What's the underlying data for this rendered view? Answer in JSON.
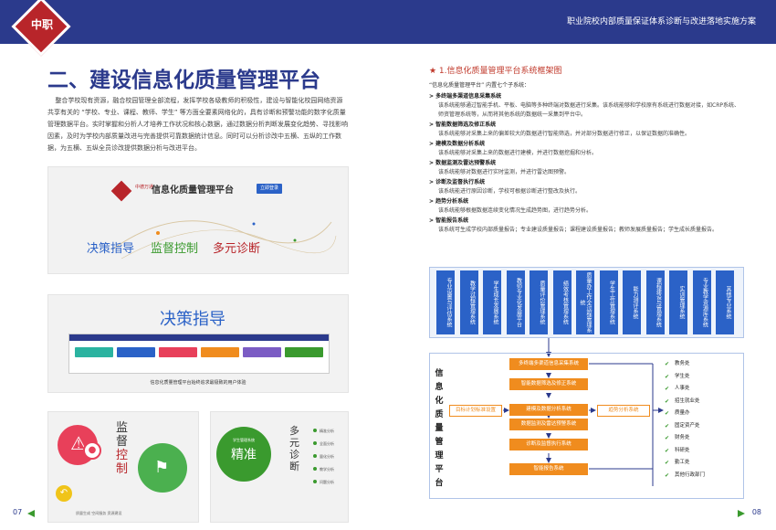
{
  "header": {
    "logo_text": "中职",
    "title": "职业院校内部质量保证体系诊断与改进落地实施方案"
  },
  "left": {
    "section_title": "二、建设信息化质量管理平台",
    "intro": "整合学校现有资源，融合校园管理全部流程，发挥学校各级教师的积极性，建设与智能化校园网络资源共享有关的 “学校、专业、课程、教师、学生” 等方面全要素网络化的，具有诊断和预警功能的数字化质量管理数据平台。实时掌握和分析人才培养工作状况和核心数据，通过数据分析判断发展变化趋势、寻找影响因素，及时为学校内部质量改进与完善提供可靠数据统计信息。同时可以分析诊改中五横、五纵的工作数据，为五横、五纵全员诊改提供数据分析与改进平台。",
    "card1": {
      "brand_small": "中德万通",
      "brand_name": "信息化质量管理平台",
      "login": "立即登录",
      "slogan1": "决策指导",
      "slogan2": "监督控制",
      "slogan3": "多元诊断"
    },
    "card2": {
      "title": "决策指导",
      "caption": "信息化质量管理平台始终追求最极致的用户体验",
      "tile_colors": [
        "#2bb3a0",
        "#2b62c7",
        "#e8405a",
        "#f08c1e",
        "#7b5cc4",
        "#3a9a2e"
      ]
    },
    "card3": {
      "vert1": "监督",
      "vert2": "控制",
      "caption": "质量生成  空间服务  资源建设"
    },
    "card4": {
      "circle_small": "学生管理系统",
      "circle_big": "精准",
      "vert": "多元诊断",
      "list": [
        "精准分析",
        "全面分析",
        "量化分析",
        "教学分析",
        "问题分析"
      ]
    },
    "page_num": "07"
  },
  "right": {
    "heading": "★ 1.信息化质量管理平台系统框架图",
    "lead": "“信息化质量管理平台” 内置七个子系统：",
    "items": [
      {
        "title": "> 多终端多渠道信息采集系统",
        "desc": "该系统能够通过智能手机、平板、电脑等多种终端对数据进行采集。该系统能够和学校原有系统进行数据对接，如CRP系统、师资管理系统等，从而将其他系统的数据统一采集到平台中。"
      },
      {
        "title": "> 智能数据筛选及修正系统",
        "desc": "该系统能够对采集上来的偏差较大的数据进行智能筛选，并对部分数据进行修正，以保证数据的准确性。"
      },
      {
        "title": "> 建模及数据分析系统",
        "desc": "该系统能够对采集上来的数据进行建模，并进行数据挖掘和分析。"
      },
      {
        "title": "> 数据监测及雷达预警系统",
        "desc": "该系统能够对数据进行实时监测，并进行雷达图预警。"
      },
      {
        "title": "> 诊断及监督执行系统",
        "desc": "该系统能进行原因诊断，学校可根据诊断进行整改及执行。"
      },
      {
        "title": "> 趋势分析系统",
        "desc": "该系统能够根据数据连续变化情况生成趋势图，进行趋势分析。"
      },
      {
        "title": "> 智能报告系统",
        "desc": "该系统可生成学校内部质量报告；专业建设质量报告；课程建设质量报告；教师发展质量报告；学生成长质量报告。"
      }
    ],
    "flow": {
      "subsystems": [
        "专业设置与评估系统",
        "教学过程管理系统",
        "学生成长发展系统",
        "教师专业化发展平台",
        "质量评价管理系统",
        "绩效考核管理系统",
        "质量办工作全过程管理系统",
        "学生工作管理系统",
        "能力测评系统",
        "课程建设与管理系统",
        "实训管理系统",
        "专业教学资源库系统",
        "其他专业系统"
      ],
      "platform_label": "信息化质量管理平台",
      "main_boxes": [
        "多终端多渠道信息采集系统",
        "智能数据筛选及修正系统",
        "建模及数据分析系统",
        "数据监测及雷达预警系统",
        "诊断及监督执行系统",
        "智能报告系统"
      ],
      "target_box": "目标计划标准设置",
      "trend_box": "趋势分析系统",
      "departments": [
        "教务处",
        "学生处",
        "人事处",
        "招生就业处",
        "质量办",
        "固定资产处",
        "财务处",
        "科研处",
        "勤工处",
        "其他行政部门"
      ]
    },
    "page_num": "08"
  }
}
